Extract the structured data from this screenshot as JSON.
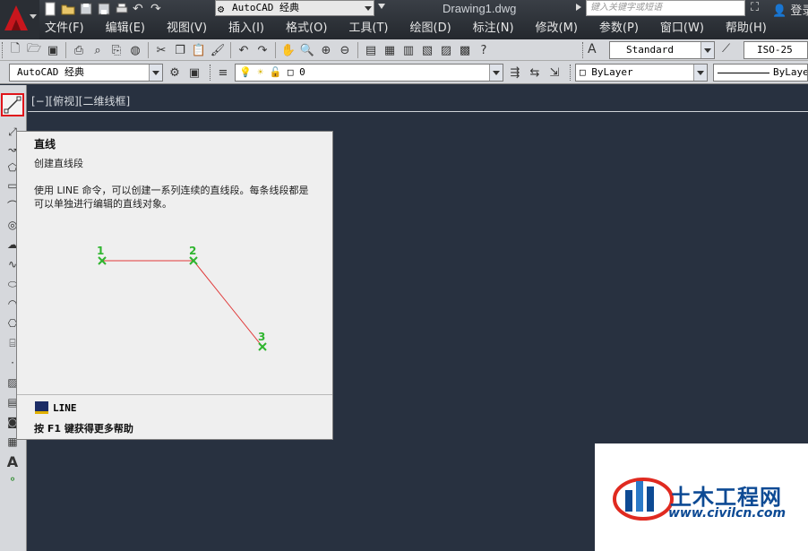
{
  "titlebar": {
    "workspace": "AutoCAD 经典",
    "document_title": "Drawing1.dwg",
    "search_placeholder": "键入关键字或短语",
    "login": "登录"
  },
  "menu": [
    "文件(F)",
    "编辑(E)",
    "视图(V)",
    "插入(I)",
    "格式(O)",
    "工具(T)",
    "绘图(D)",
    "标注(N)",
    "修改(M)",
    "参数(P)",
    "窗口(W)",
    "帮助(H)"
  ],
  "toolbar": {
    "text_style": "Standard",
    "dim_style": "ISO-25",
    "workspace_combo": "AutoCAD 经典",
    "layer_combo": "0",
    "color_combo": "ByLayer",
    "linetype_combo": "ByLayer"
  },
  "viewport": {
    "label": "[−][俯视][二维线框]"
  },
  "tooltip": {
    "title": "直线",
    "subtitle": "创建直线段",
    "description_line1": "使用 LINE 命令，可以创建一系列连续的直线段。每条线段都是",
    "description_line2": "可以单独进行编辑的直线对象。",
    "point_labels": [
      "1",
      "2",
      "3"
    ],
    "command": "LINE",
    "help": "按 F1 键获得更多帮助"
  },
  "watermark": {
    "name": "土木工程网",
    "url": "www.civilcn.com"
  },
  "colors": {
    "canvas": "#283140",
    "toolbar": "#d6d8dc",
    "highlight": "#e0141a",
    "point_marker": "#2fb52f",
    "segment": "#e03a3a"
  }
}
